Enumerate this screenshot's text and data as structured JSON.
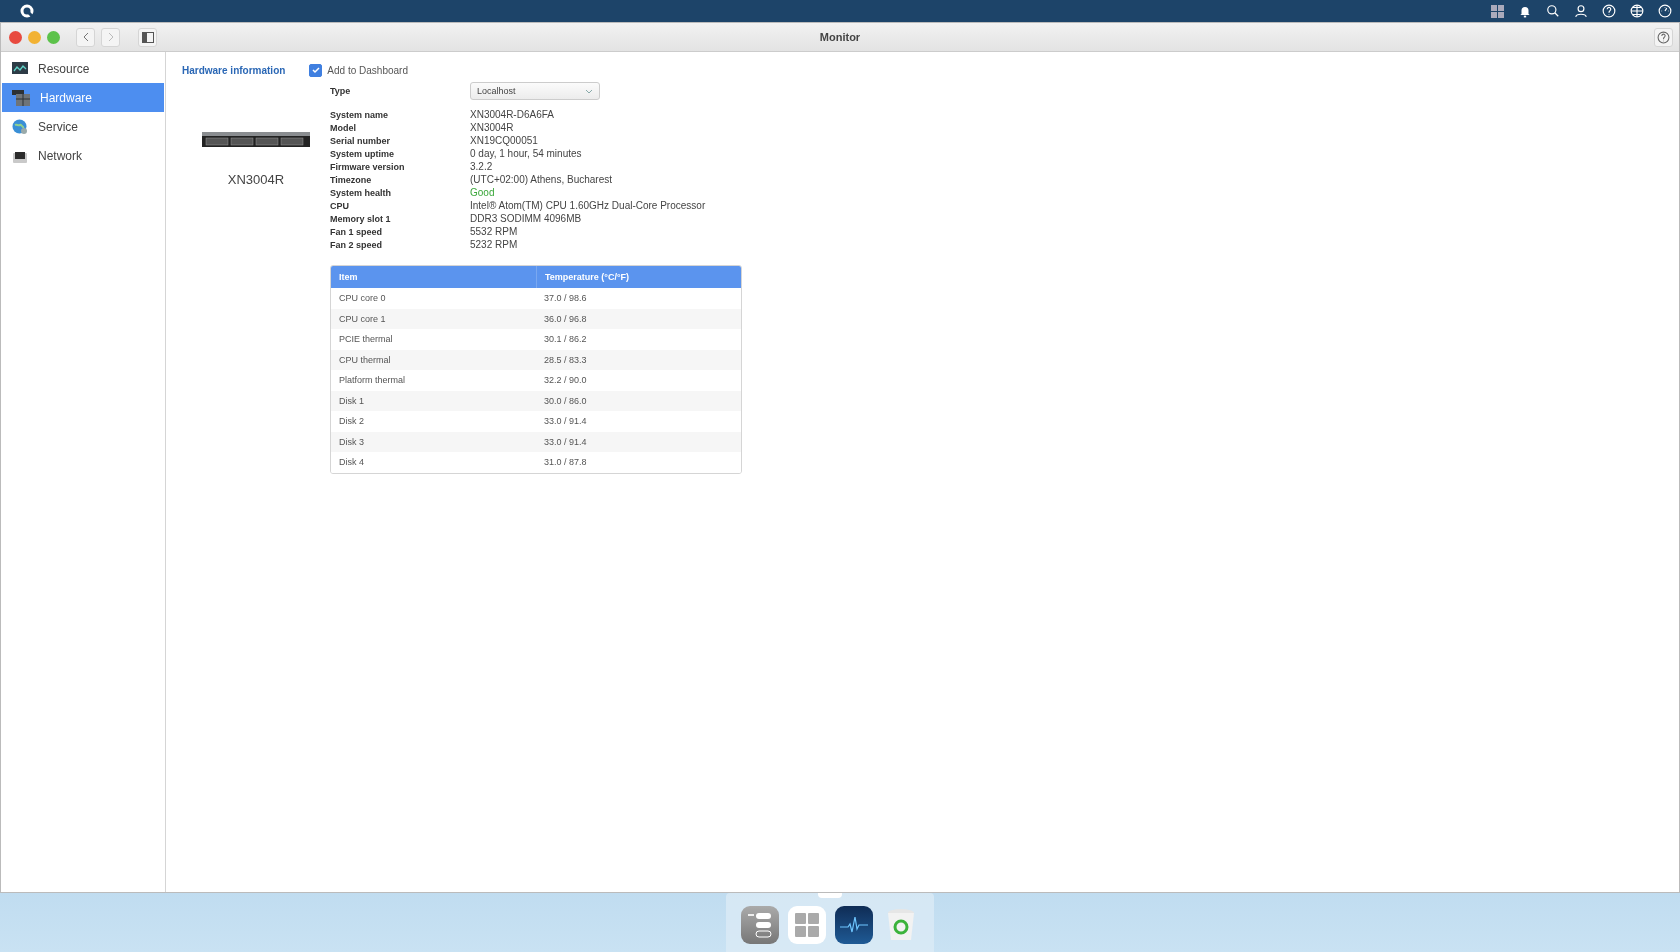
{
  "window": {
    "title": "Monitor"
  },
  "sidebar": {
    "items": [
      {
        "label": "Resource",
        "selected": false
      },
      {
        "label": "Hardware",
        "selected": true
      },
      {
        "label": "Service",
        "selected": false
      },
      {
        "label": "Network",
        "selected": false
      }
    ]
  },
  "content": {
    "section_title": "Hardware information",
    "add_to_dashboard": {
      "label": "Add to Dashboard",
      "checked": true
    },
    "device_name": "XN3004R",
    "type": {
      "label": "Type",
      "value": "Localhost"
    },
    "info": [
      {
        "label": "System name",
        "value": "XN3004R-D6A6FA"
      },
      {
        "label": "Model",
        "value": "XN3004R"
      },
      {
        "label": "Serial number",
        "value": "XN19CQ00051"
      },
      {
        "label": "System uptime",
        "value": "0 day, 1 hour, 54 minutes"
      },
      {
        "label": "Firmware version",
        "value": "3.2.2"
      },
      {
        "label": "Timezone",
        "value": "(UTC+02:00) Athens, Bucharest"
      },
      {
        "label": "System health",
        "value": "Good",
        "color": "#3aa73a"
      },
      {
        "label": "CPU",
        "value": "Intel® Atom(TM) CPU 1.60GHz Dual-Core Processor"
      },
      {
        "label": "Memory slot 1",
        "value": "DDR3 SODIMM 4096MB"
      },
      {
        "label": "Fan 1 speed",
        "value": "5532 RPM"
      },
      {
        "label": "Fan 2 speed",
        "value": "5232 RPM"
      }
    ],
    "table": {
      "columns": [
        "Item",
        "Temperature (°C/°F)"
      ],
      "rows": [
        [
          "CPU core 0",
          "37.0 / 98.6"
        ],
        [
          "CPU core 1",
          "36.0 / 96.8"
        ],
        [
          "PCIE thermal",
          "30.1 / 86.2"
        ],
        [
          "CPU thermal",
          "28.5 / 83.3"
        ],
        [
          "Platform thermal",
          "32.2 / 90.0"
        ],
        [
          "Disk 1",
          "30.0 / 86.0"
        ],
        [
          "Disk 2",
          "33.0 / 91.4"
        ],
        [
          "Disk 3",
          "33.0 / 91.4"
        ],
        [
          "Disk 4",
          "31.0 / 87.8"
        ]
      ]
    }
  }
}
